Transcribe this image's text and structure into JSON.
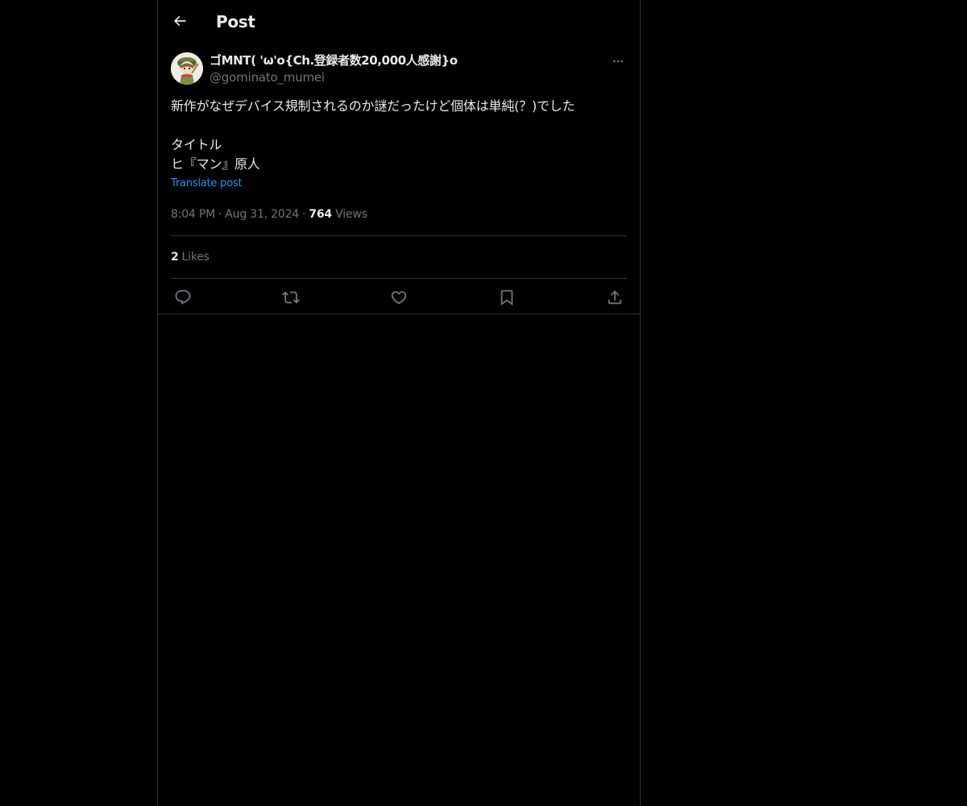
{
  "header": {
    "title": "Post",
    "back_icon": "arrow-left-icon"
  },
  "post": {
    "author": {
      "display_name": "ゴMNT( 'ω'o{Ch.登録者数20,000人感謝}o",
      "handle": "@gominato_mumei"
    },
    "more_icon": "more-horizontal-icon",
    "text": "新作がなぜデバイス規制されるのか謎だったけど個体は単純(？)でした\n\nタイトル\nヒ『マン』原人",
    "translate_label": "Translate post",
    "time": "8:04 PM",
    "date": "Aug 31, 2024",
    "views_count": "764",
    "views_label": "Views",
    "dot": "·",
    "likes_count": "2",
    "likes_label": "Likes"
  },
  "actions": [
    {
      "name": "reply",
      "icon": "reply-icon"
    },
    {
      "name": "repost",
      "icon": "repost-icon"
    },
    {
      "name": "like",
      "icon": "heart-icon"
    },
    {
      "name": "bookmark",
      "icon": "bookmark-icon"
    },
    {
      "name": "share",
      "icon": "share-icon"
    }
  ],
  "colors": {
    "background": "#000000",
    "text_primary": "#e7e9ea",
    "text_secondary": "#71767b",
    "link": "#1d9bf0",
    "border": "#2f3336"
  }
}
